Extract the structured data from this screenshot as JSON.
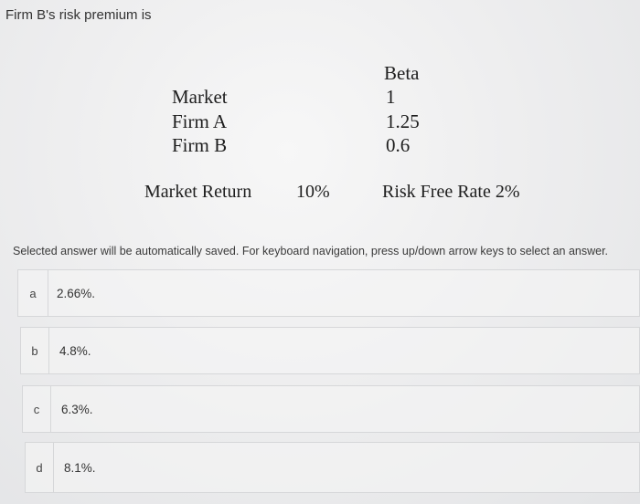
{
  "question": {
    "text": "Firm B's risk premium is"
  },
  "table": {
    "beta_header": "Beta",
    "rows": [
      {
        "name": "Market",
        "beta": "1"
      },
      {
        "name": "Firm A",
        "beta": "1.25"
      },
      {
        "name": "Firm B",
        "beta": "0.6"
      }
    ],
    "market_return_label": "Market Return",
    "market_return_value": "10%",
    "risk_free_label": "Risk Free Rate 2%"
  },
  "instructions": "Selected answer will be automatically saved. For keyboard navigation, press up/down arrow keys to select an answer.",
  "options": [
    {
      "letter": "a",
      "text": "2.66%."
    },
    {
      "letter": "b",
      "text": "4.8%."
    },
    {
      "letter": "c",
      "text": "6.3%."
    },
    {
      "letter": "d",
      "text": "8.1%."
    }
  ]
}
